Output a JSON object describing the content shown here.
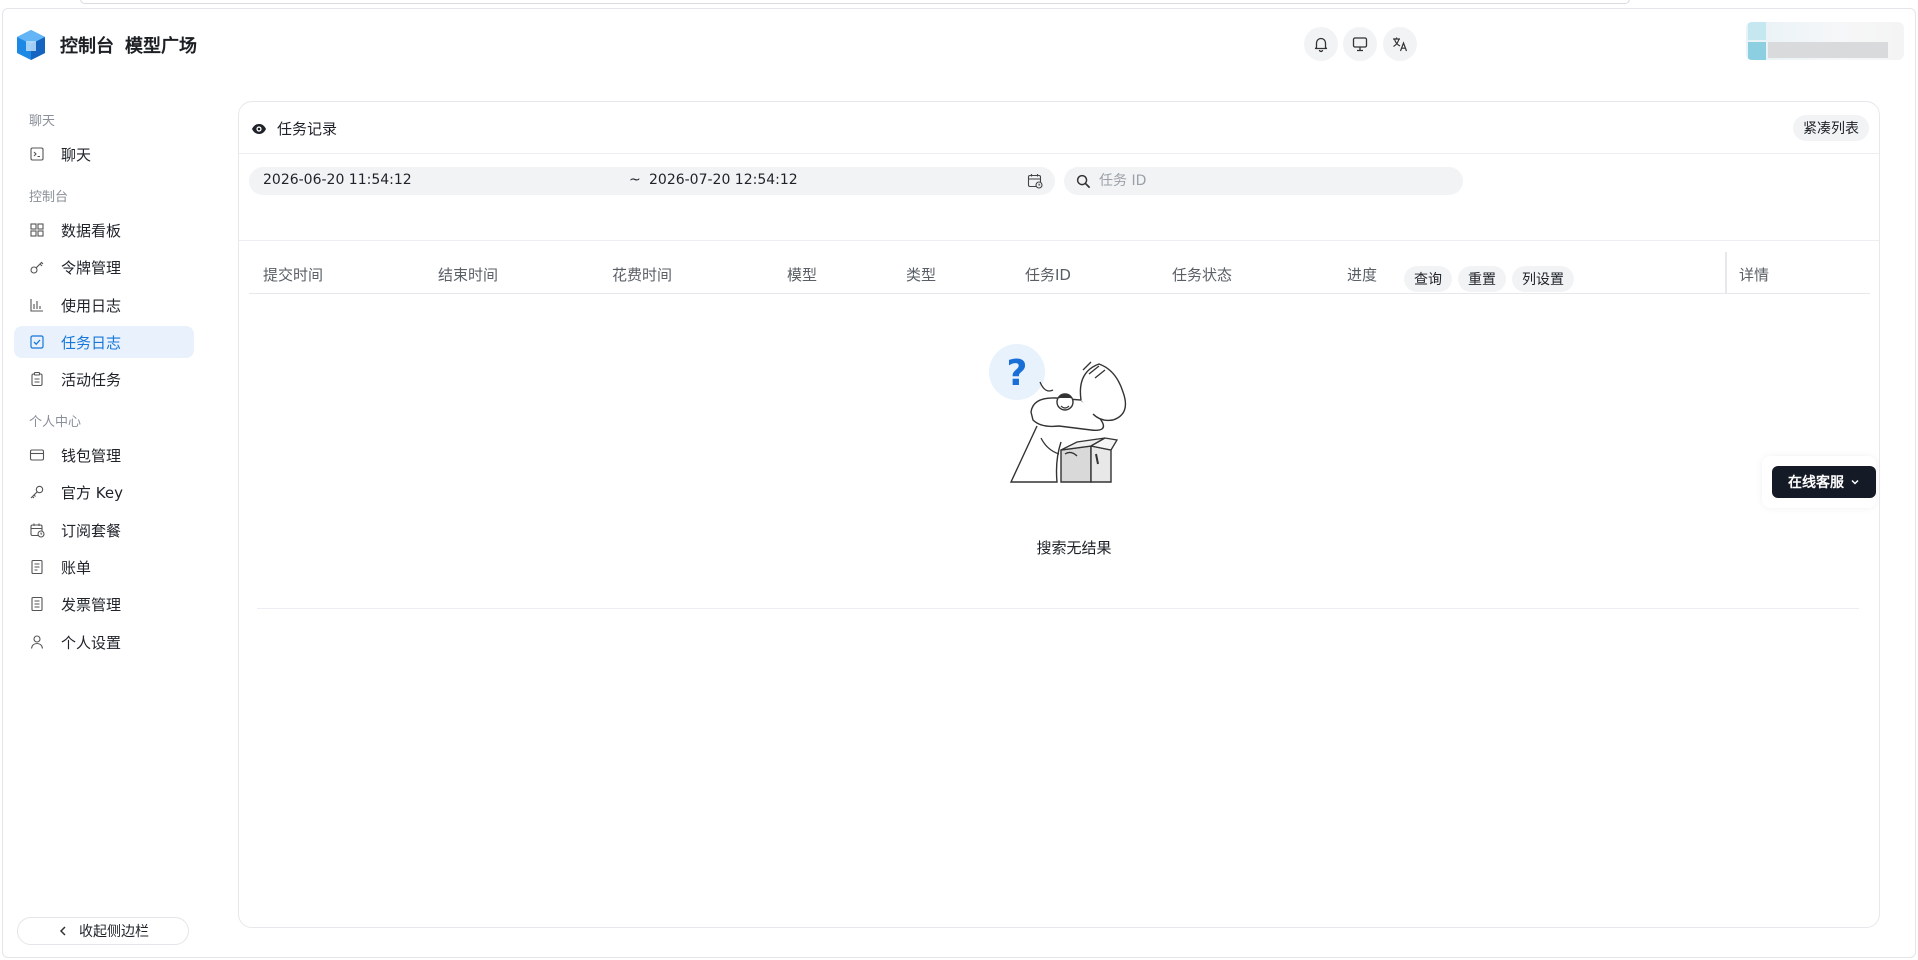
{
  "header": {
    "nav": [
      "控制台",
      "模型广场"
    ],
    "icons": [
      "bell-icon",
      "monitor-icon",
      "translate-icon"
    ]
  },
  "sidebar": {
    "sections": [
      {
        "title": "聊天",
        "items": [
          {
            "label": "聊天",
            "icon": "chat-icon"
          }
        ]
      },
      {
        "title": "控制台",
        "items": [
          {
            "label": "数据看板",
            "icon": "dashboard-icon"
          },
          {
            "label": "令牌管理",
            "icon": "key-icon"
          },
          {
            "label": "使用日志",
            "icon": "bar-chart-icon"
          },
          {
            "label": "任务日志",
            "icon": "checkbox-icon",
            "active": true
          },
          {
            "label": "活动任务",
            "icon": "clipboard-icon"
          }
        ]
      },
      {
        "title": "个人中心",
        "items": [
          {
            "label": "钱包管理",
            "icon": "wallet-icon"
          },
          {
            "label": "官方 Key",
            "icon": "key-icon"
          },
          {
            "label": "订阅套餐",
            "icon": "calendar-clock-icon"
          },
          {
            "label": "账单",
            "icon": "receipt-icon"
          },
          {
            "label": "发票管理",
            "icon": "invoice-icon"
          },
          {
            "label": "个人设置",
            "icon": "user-icon"
          }
        ]
      }
    ],
    "collapse_label": "收起侧边栏"
  },
  "main": {
    "title": "任务记录",
    "compact_label": "紧凑列表",
    "date_start": "2026-06-20 11:54:12",
    "date_sep": "~",
    "date_end": "2026-07-20 12:54:12",
    "search_placeholder": "任务 ID",
    "query_label": "查询",
    "reset_label": "重置",
    "column_settings_label": "列设置",
    "columns": [
      "提交时间",
      "结束时间",
      "花费时间",
      "模型",
      "类型",
      "任务ID",
      "任务状态",
      "进度",
      "详情"
    ],
    "rows": [],
    "empty_text": "搜索无结果"
  },
  "support": {
    "label": "在线客服"
  },
  "colors": {
    "accent": "#1677d9",
    "active_bg": "#e8f1fc",
    "support_bg": "#141a26"
  }
}
